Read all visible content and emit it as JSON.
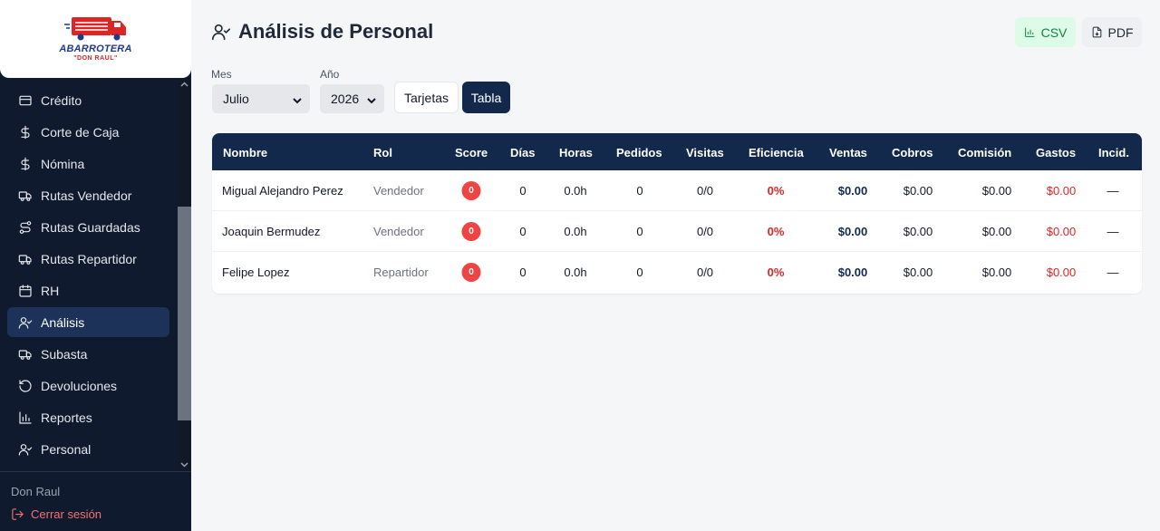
{
  "brand": {
    "name": "ABARROTERA",
    "subtitle": "\"DON RAUL\""
  },
  "sidebar": {
    "items": [
      {
        "label": "Crédito",
        "icon": "credit-card-icon",
        "active": false
      },
      {
        "label": "Corte de Caja",
        "icon": "dollar-icon",
        "active": false
      },
      {
        "label": "Nómina",
        "icon": "dollar-icon",
        "active": false
      },
      {
        "label": "Rutas Vendedor",
        "icon": "truck-icon",
        "active": false
      },
      {
        "label": "Rutas Guardadas",
        "icon": "route-icon",
        "active": false
      },
      {
        "label": "Rutas Repartidor",
        "icon": "truck-icon",
        "active": false
      },
      {
        "label": "RH",
        "icon": "calendar-icon",
        "active": false
      },
      {
        "label": "Análisis",
        "icon": "user-check-icon",
        "active": true
      },
      {
        "label": "Subasta",
        "icon": "truck-icon",
        "active": false
      },
      {
        "label": "Devoluciones",
        "icon": "rotate-ccw-icon",
        "active": false
      },
      {
        "label": "Reportes",
        "icon": "bar-chart-icon",
        "active": false
      },
      {
        "label": "Personal",
        "icon": "user-check-icon",
        "active": false
      }
    ],
    "user_name": "Don Raul",
    "logout_label": "Cerrar sesión"
  },
  "header": {
    "title": "Análisis de Personal",
    "csv_label": "CSV",
    "pdf_label": "PDF"
  },
  "filters": {
    "month_label": "Mes",
    "month_value": "Julio",
    "year_label": "Año",
    "year_value": "2026",
    "view_cards_label": "Tarjetas",
    "view_table_label": "Tabla"
  },
  "table": {
    "columns": [
      "Nombre",
      "Rol",
      "Score",
      "Días",
      "Horas",
      "Pedidos",
      "Visitas",
      "Eficiencia",
      "Ventas",
      "Cobros",
      "Comisión",
      "Gastos",
      "Incid."
    ],
    "rows": [
      {
        "nombre": "Migual Alejandro Perez",
        "rol": "Vendedor",
        "score": "0",
        "dias": "0",
        "horas": "0.0h",
        "pedidos": "0",
        "visitas": "0/0",
        "eficiencia": "0%",
        "ventas": "$0.00",
        "cobros": "$0.00",
        "comision": "$0.00",
        "gastos": "$0.00",
        "incid": "—"
      },
      {
        "nombre": "Joaquin Bermudez",
        "rol": "Vendedor",
        "score": "0",
        "dias": "0",
        "horas": "0.0h",
        "pedidos": "0",
        "visitas": "0/0",
        "eficiencia": "0%",
        "ventas": "$0.00",
        "cobros": "$0.00",
        "comision": "$0.00",
        "gastos": "$0.00",
        "incid": "—"
      },
      {
        "nombre": "Felipe Lopez",
        "rol": "Repartidor",
        "score": "0",
        "dias": "0",
        "horas": "0.0h",
        "pedidos": "0",
        "visitas": "0/0",
        "eficiencia": "0%",
        "ventas": "$0.00",
        "cobros": "$0.00",
        "comision": "$0.00",
        "gastos": "$0.00",
        "incid": "—"
      }
    ]
  },
  "colors": {
    "sidebar_bg": "#0f1a2e",
    "header_bg": "#13294b",
    "accent_red": "#dc2626",
    "csv_green": "#15803d"
  }
}
